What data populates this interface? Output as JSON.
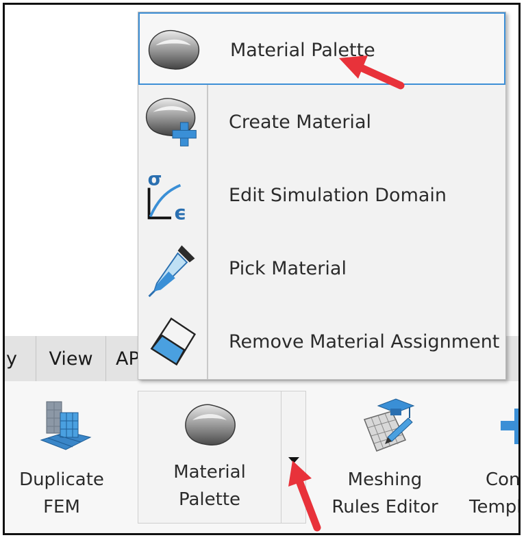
{
  "menu_tabs": [
    {
      "label": "y"
    },
    {
      "label": "View"
    },
    {
      "label": "AP"
    }
  ],
  "ribbon": {
    "duplicate_fem": {
      "line1": "Duplicate",
      "line2": "FEM"
    },
    "material_palette": {
      "line1": "Material",
      "line2": "Palette"
    },
    "meshing_rules_editor": {
      "line1": "Meshing",
      "line2": "Rules Editor"
    },
    "partial_cut": {
      "line1": "Con",
      "line2": "Templ"
    }
  },
  "dropdown": {
    "items": [
      {
        "label": "Material Palette",
        "icon": "material-palette-icon",
        "selected": true
      },
      {
        "label": "Create Material",
        "icon": "create-material-icon"
      },
      {
        "label": "Edit Simulation Domain",
        "icon": "stress-strain-icon"
      },
      {
        "label": "Pick Material",
        "icon": "eyedropper-icon"
      },
      {
        "label": "Remove Material Assignment",
        "icon": "eraser-icon"
      }
    ]
  },
  "colors": {
    "accent": "#3d8fd6",
    "arrow": "#e8323a"
  }
}
